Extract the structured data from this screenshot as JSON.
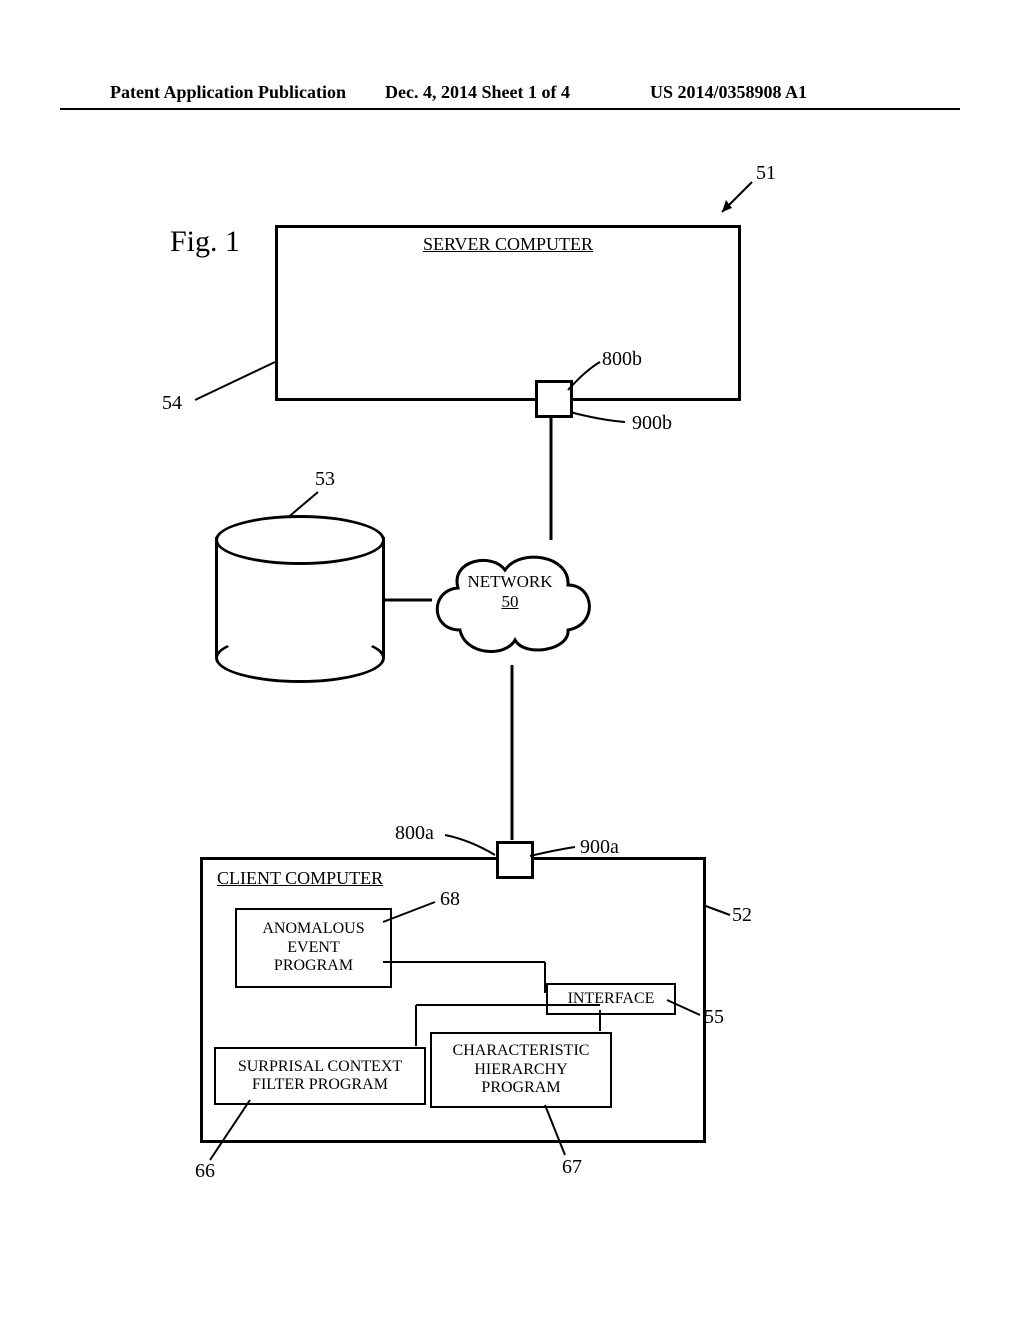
{
  "header": {
    "left": "Patent Application Publication",
    "center": "Dec. 4, 2014  Sheet 1 of 4",
    "right": "US 2014/0358908 A1"
  },
  "figure_label": "Fig. 1",
  "server": {
    "title": "SERVER COMPUTER"
  },
  "network": {
    "label": "NETWORK",
    "id": "50"
  },
  "client": {
    "title": "CLIENT COMPUTER",
    "anomalous": {
      "l1": "ANOMALOUS",
      "l2": "EVENT",
      "l3": "PROGRAM"
    },
    "scf": {
      "l1": "SURPRISAL CONTEXT",
      "l2": "FILTER PROGRAM"
    },
    "chp": {
      "l1": "CHARACTERISTIC",
      "l2": "HIERARCHY",
      "l3": "PROGRAM"
    },
    "interface": "INTERFACE"
  },
  "refs": {
    "r51": "51",
    "r54": "54",
    "r53": "53",
    "r800b": "800b",
    "r900b": "900b",
    "r800a": "800a",
    "r900a": "900a",
    "r52": "52",
    "r68": "68",
    "r55": "55",
    "r66": "66",
    "r67": "67"
  }
}
